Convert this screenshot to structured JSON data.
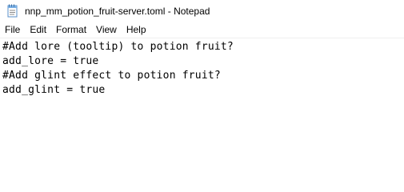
{
  "window": {
    "title": "nnp_mm_potion_fruit-server.toml - Notepad",
    "icon": "notepad-icon"
  },
  "menu": {
    "items": [
      "File",
      "Edit",
      "Format",
      "View",
      "Help"
    ]
  },
  "editor": {
    "lines": [
      "#Add lore (tooltip) to potion fruit?",
      "add_lore = true",
      "#Add glint effect to potion fruit?",
      "add_glint = true"
    ]
  }
}
